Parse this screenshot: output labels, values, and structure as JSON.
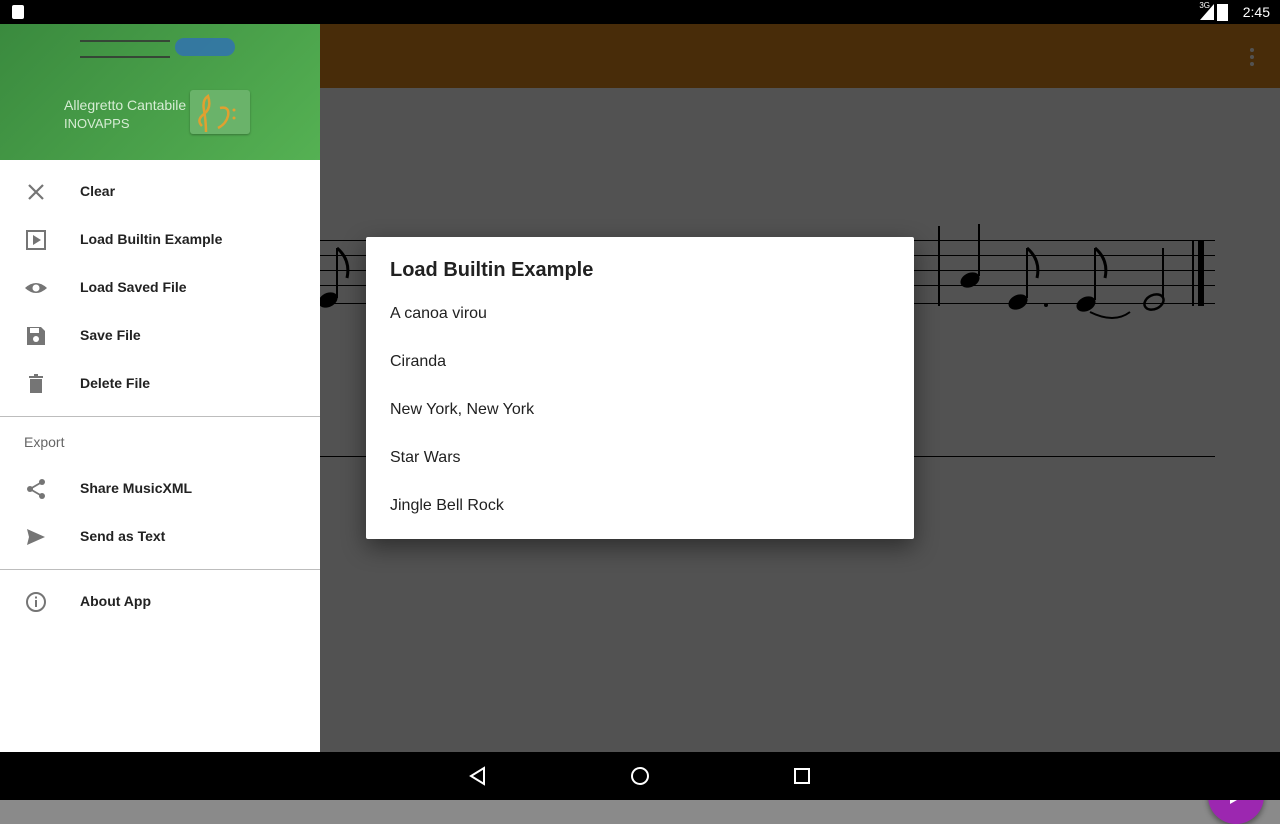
{
  "status_bar": {
    "network": "3G",
    "time": "2:45"
  },
  "drawer": {
    "app_name": "Allegretto Cantabile",
    "app_org": "INOVAPPS",
    "items": [
      {
        "label": "Clear",
        "icon": "close-icon"
      },
      {
        "label": "Load Builtin Example",
        "icon": "play-box-icon"
      },
      {
        "label": "Load Saved File",
        "icon": "eye-icon"
      },
      {
        "label": "Save File",
        "icon": "save-icon"
      },
      {
        "label": "Delete File",
        "icon": "trash-icon"
      }
    ],
    "export_header": "Export",
    "export_items": [
      {
        "label": "Share MusicXML",
        "icon": "share-icon"
      },
      {
        "label": "Send as Text",
        "icon": "send-icon"
      }
    ],
    "about_item": {
      "label": "About App",
      "icon": "info-icon"
    }
  },
  "dialog": {
    "title": "Load Builtin Example",
    "options": [
      "A canoa virou",
      "Ciranda",
      "New York, New York",
      "Star Wars",
      "Jingle Bell Rock"
    ]
  },
  "colors": {
    "app_bar": "#e08a1c",
    "drawer_header": "#4caf50",
    "fab": "#9c27b0"
  }
}
